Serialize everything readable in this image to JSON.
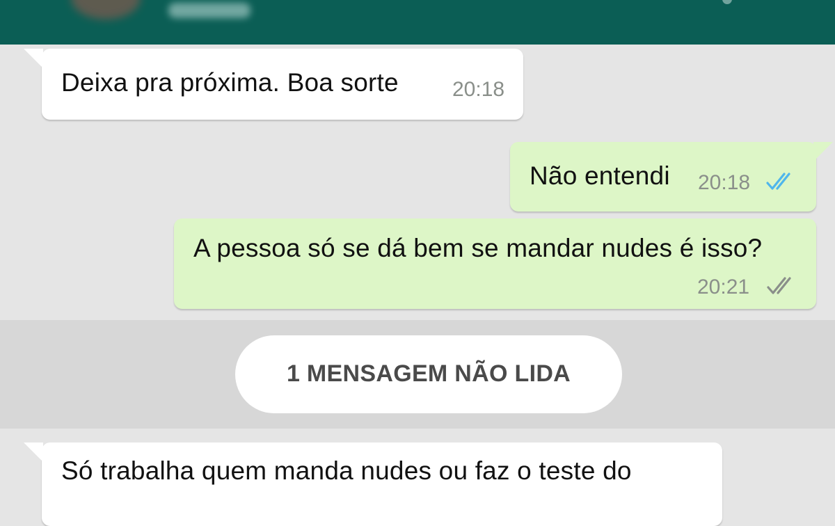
{
  "header": {
    "contact_name": "",
    "background_color": "#0b5e55"
  },
  "messages": [
    {
      "direction": "incoming",
      "text": "Deixa pra próxima. Boa sorte",
      "time": "20:18"
    },
    {
      "direction": "outgoing",
      "text": "Não entendi",
      "time": "20:18",
      "status": "read",
      "status_icon": "double-check-icon"
    },
    {
      "direction": "outgoing",
      "text": "A pessoa só se dá bem se mandar nudes é isso?",
      "time": "20:21",
      "status": "delivered",
      "status_icon": "double-check-icon"
    },
    {
      "direction": "incoming",
      "text": "Só trabalha quem manda nudes ou faz o teste do"
    }
  ],
  "unread_banner": {
    "label": "1 MENSAGEM NÃO LIDA"
  },
  "colors": {
    "chat_background": "#e5e5e5",
    "incoming_bubble": "#ffffff",
    "outgoing_bubble": "#ddf6c7",
    "read_tick": "#4fb6ec",
    "delivered_tick": "#8a8f8a",
    "unread_band": "#d7d7d7"
  }
}
